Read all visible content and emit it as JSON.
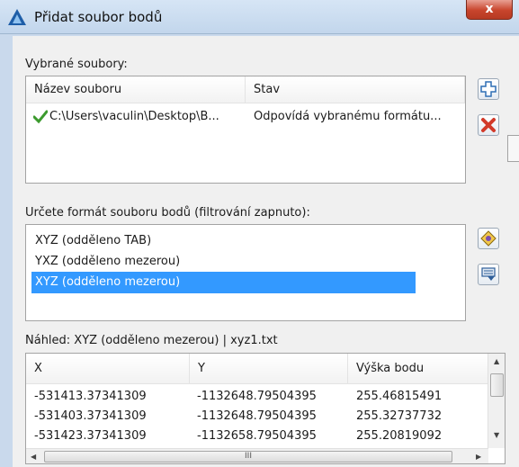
{
  "window": {
    "title": "Přidat soubor bodů",
    "close_glyph": "x"
  },
  "selected_files": {
    "label": "Vybrané soubory:",
    "columns": [
      "Název souboru",
      "Stav"
    ],
    "rows": [
      {
        "status_icon": "checkmark-icon",
        "file": "C:\\Users\\vaculin\\Desktop\\B...",
        "state": "Odpovídá vybranému formátu..."
      }
    ],
    "add_icon": "add-file-icon",
    "remove_icon": "remove-file-icon"
  },
  "format": {
    "label": "Určete formát souboru bodů (filtrování zapnuto):",
    "items": [
      "XYZ (odděleno TAB)",
      "YXZ (odděleno mezerou)",
      "XYZ (odděleno mezerou)"
    ],
    "selected_index": 2,
    "manage_icon": "format-manager-icon",
    "filter_icon": "filter-icon"
  },
  "preview": {
    "label": "Náhled: XYZ (odděleno mezerou) | xyz1.txt",
    "columns": [
      "X",
      "Y",
      "Výška bodu"
    ],
    "rows": [
      [
        "-531413.37341309",
        "-1132648.79504395",
        "255.46815491"
      ],
      [
        "-531403.37341309",
        "-1132648.79504395",
        "255.32737732"
      ],
      [
        "-531423.37341309",
        "-1132658.79504395",
        "255.20819092"
      ]
    ],
    "hscroll_grip": "III"
  },
  "colors": {
    "accent_selection": "#3399ff",
    "check_green": "#3c9a2e",
    "remove_red": "#d23a2a",
    "close_red": "#c8442c"
  }
}
